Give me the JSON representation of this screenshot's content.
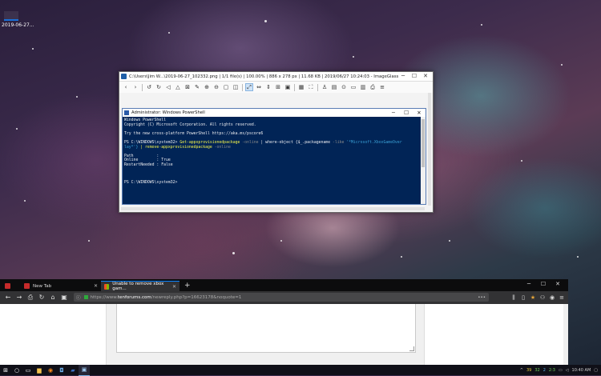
{
  "desktop": {
    "icon_label": "2019-06-27..."
  },
  "imageglass": {
    "title": "C:\\Users\\Jim W...\\2019-06-27_102332.png  |  1/1 file(s)  |  100.00%  |  886 x 278 px  |  11.68 KB  |  2019/06/27 10:24:03  - ImageGlass",
    "window_buttons": [
      "─",
      "☐",
      "✕"
    ]
  },
  "powershell": {
    "title": "Administrator: Windows PowerShell",
    "window_buttons": [
      "─",
      "☐",
      "✕"
    ],
    "lines": [
      "Windows PowerShell",
      "Copyright (C) Microsoft Corporation. All rights reserved.",
      "",
      "Try the new cross-platform PowerShell https://aka.ms/pscore6",
      ""
    ],
    "prompt": "PS C:\\WINDOWS\\system32> ",
    "cmd_part1": "Get-appxprovisionedpackage",
    "cmd_param1": " -online ",
    "cmd_part2": "| where-object {$_.packagename ",
    "cmd_param2": "-like ",
    "cmd_string": "'*Microsoft.XboxGameOver",
    "cmd_line2_a": "lay*'} ",
    "cmd_line2_b": "| remove-appxprovisionedpackage",
    "cmd_param3": " -online",
    "output": [
      "",
      "Path          :",
      "Online        : True",
      "RestartNeeded : False",
      "",
      "",
      ""
    ],
    "final_prompt": "PS C:\\WINDOWS\\system32>"
  },
  "firefox": {
    "tabs": [
      {
        "label": "New Tab"
      },
      {
        "label": "Unable to remove xbox gam..."
      }
    ],
    "new_tab": "+",
    "window_buttons": [
      "─",
      "☐",
      "✕"
    ],
    "url_prefix": "https://www.",
    "url_host": "tenforums.com",
    "url_path": "/newreply.php?p=16623178&noquote=1",
    "url_menu": "•••"
  },
  "taskbar": {
    "tray_counts": [
      "39",
      "32",
      "2",
      "2:3"
    ],
    "time": "10:40 AM"
  }
}
